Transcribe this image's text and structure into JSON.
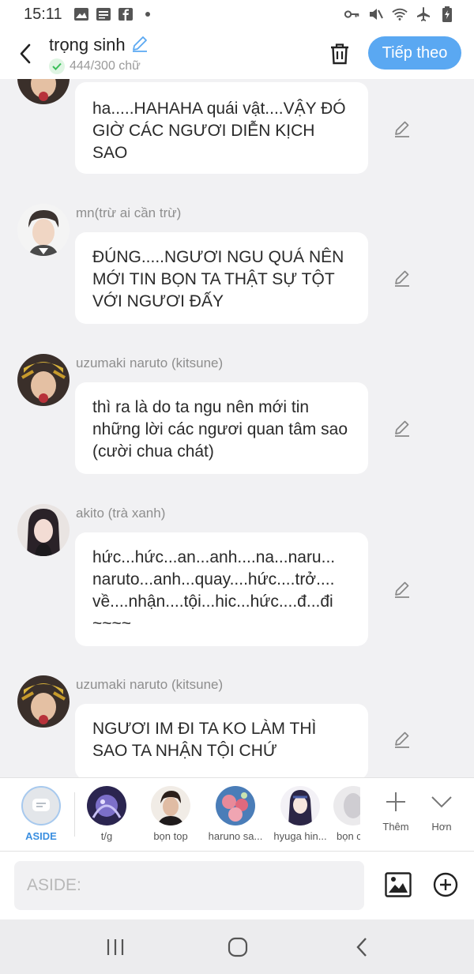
{
  "status_bar": {
    "time": "15:11"
  },
  "header": {
    "title": "trọng sinh",
    "count": "444/300 chữ",
    "next_label": "Tiếp theo"
  },
  "messages": [
    {
      "sender": "",
      "text": "ha.....HAHAHA quái vật....VẬY ĐÓ GIỜ CÁC NGƯƠI DIỄN KỊCH SAO",
      "avatar_icon": "naruto-avatar"
    },
    {
      "sender": "mn(trừ ai cần trừ)",
      "text": "ĐÚNG.....NGƯƠI NGU QUÁ NÊN MỚI TIN BỌN TA THẬT SỰ TỘT VỚI NGƯƠI ĐẤY",
      "avatar_icon": "man-avatar"
    },
    {
      "sender": "uzumaki naruto (kitsune)",
      "text": "thì ra là do ta ngu nên mới tin những lời các ngươi quan tâm sao (cười chua chát)",
      "avatar_icon": "naruto-avatar"
    },
    {
      "sender": "akito (trà xanh)",
      "text": "hức...hức...an...anh....na...naru... naruto...anh...quay....hức....trở.... về....nhận....tội...hic...hức....đ...đi ~~~~",
      "avatar_icon": "girl-avatar"
    },
    {
      "sender": "uzumaki naruto (kitsune)",
      "text": "NGƯƠI IM ĐI TA KO LÀM THÌ SAO TA NHẬN TỘI CHỨ",
      "avatar_icon": "naruto-avatar"
    }
  ],
  "characters": [
    {
      "label": "ASIDE"
    },
    {
      "label": "t/g"
    },
    {
      "label": "bọn top"
    },
    {
      "label": "haruno sa..."
    },
    {
      "label": "hyuga hin..."
    },
    {
      "label": "bọn c"
    }
  ],
  "actions": {
    "more_label": "Thêm",
    "less_label": "Hơn"
  },
  "input": {
    "placeholder": "ASIDE:"
  },
  "colors": {
    "accent": "#5aa8f2",
    "aside": "#3b8fe0",
    "background": "#f1f1f3"
  }
}
